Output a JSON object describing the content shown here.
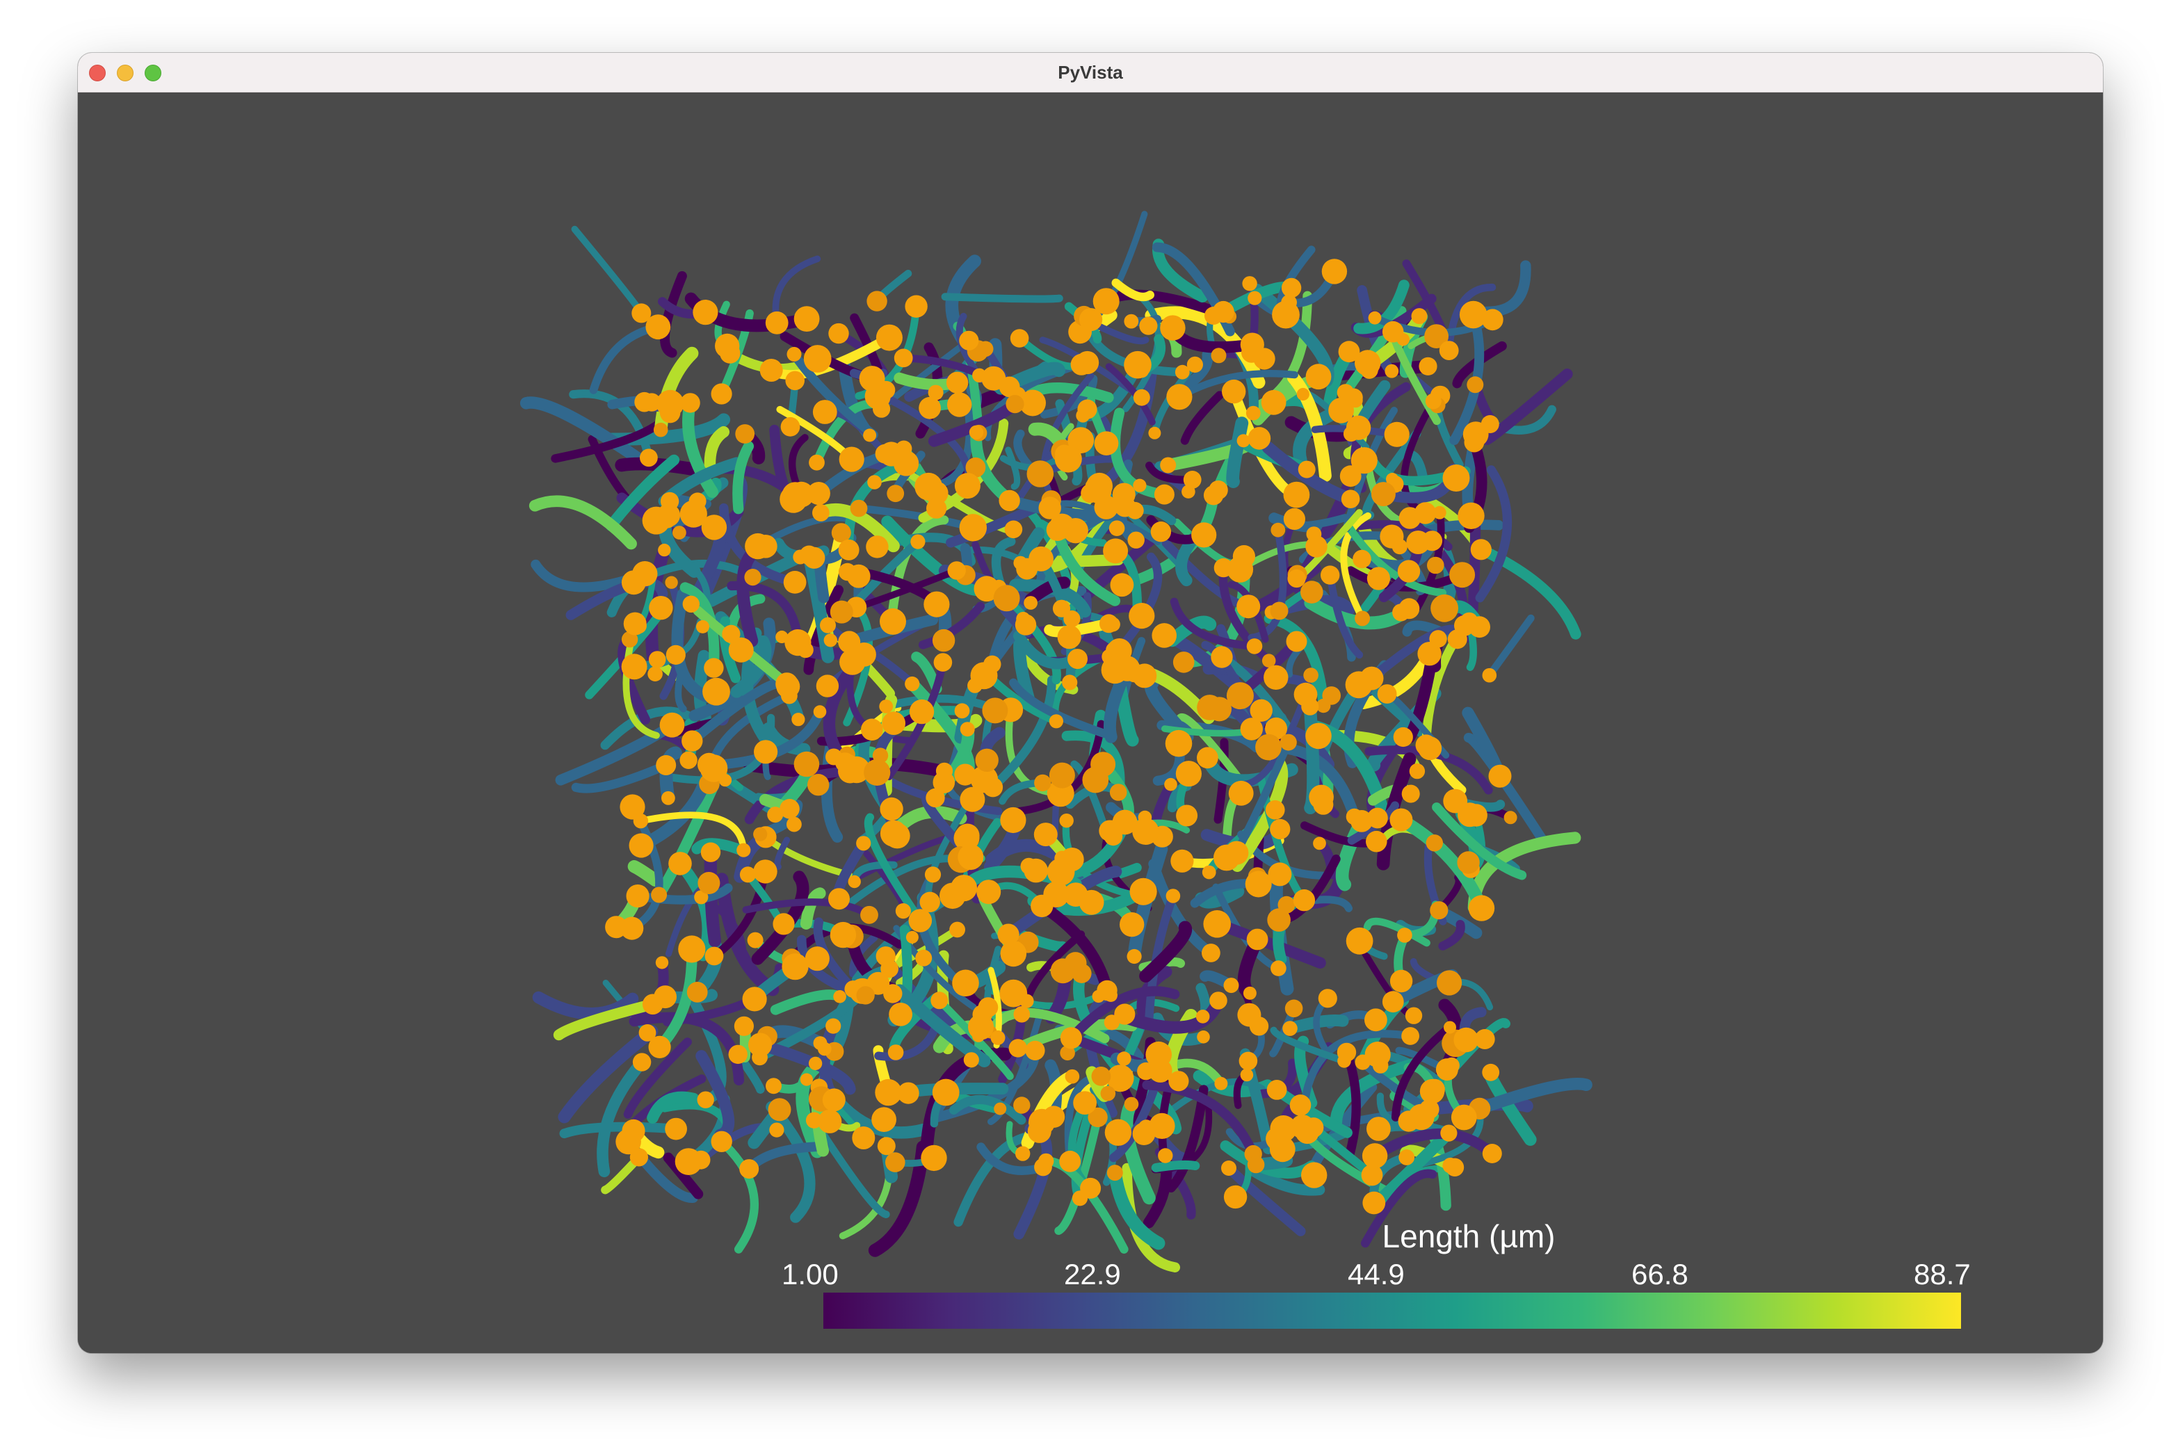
{
  "window": {
    "title": "PyVista"
  },
  "scene": {
    "background_color": "#4a4a4a",
    "node_color": "#f5a00a",
    "colormap": "viridis"
  },
  "colorbar": {
    "title": "Length (µm)",
    "ticks": [
      "1.00",
      "22.9",
      "44.9",
      "66.8",
      "88.7"
    ],
    "range": [
      1.0,
      88.7
    ]
  }
}
